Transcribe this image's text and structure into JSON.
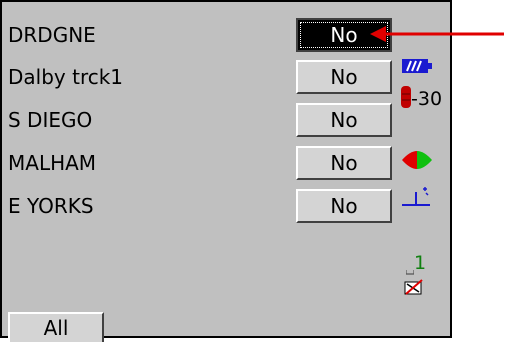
{
  "rows": [
    {
      "label": "DRDGNE",
      "value": "No",
      "selected": true
    },
    {
      "label": "Dalby trck1",
      "value": "No",
      "selected": false
    },
    {
      "label": "S DIEGO",
      "value": "No",
      "selected": false
    },
    {
      "label": "MALHAM",
      "value": "No",
      "selected": false
    },
    {
      "label": "E YORKS",
      "value": "No",
      "selected": false
    }
  ],
  "footer": {
    "all_label": "All"
  },
  "status": {
    "battery_color": "#1a1ad0",
    "signal_value": "-30",
    "signal_color": "#c00000",
    "track_index": "1",
    "track_index_color": "#108010",
    "icons": [
      "battery-icon",
      "signal-icon",
      "direction-icon",
      "waypoint-icon",
      "track-icon",
      "disabled-edit-icon"
    ]
  },
  "annotation": {
    "arrow_color": "#e00000"
  }
}
